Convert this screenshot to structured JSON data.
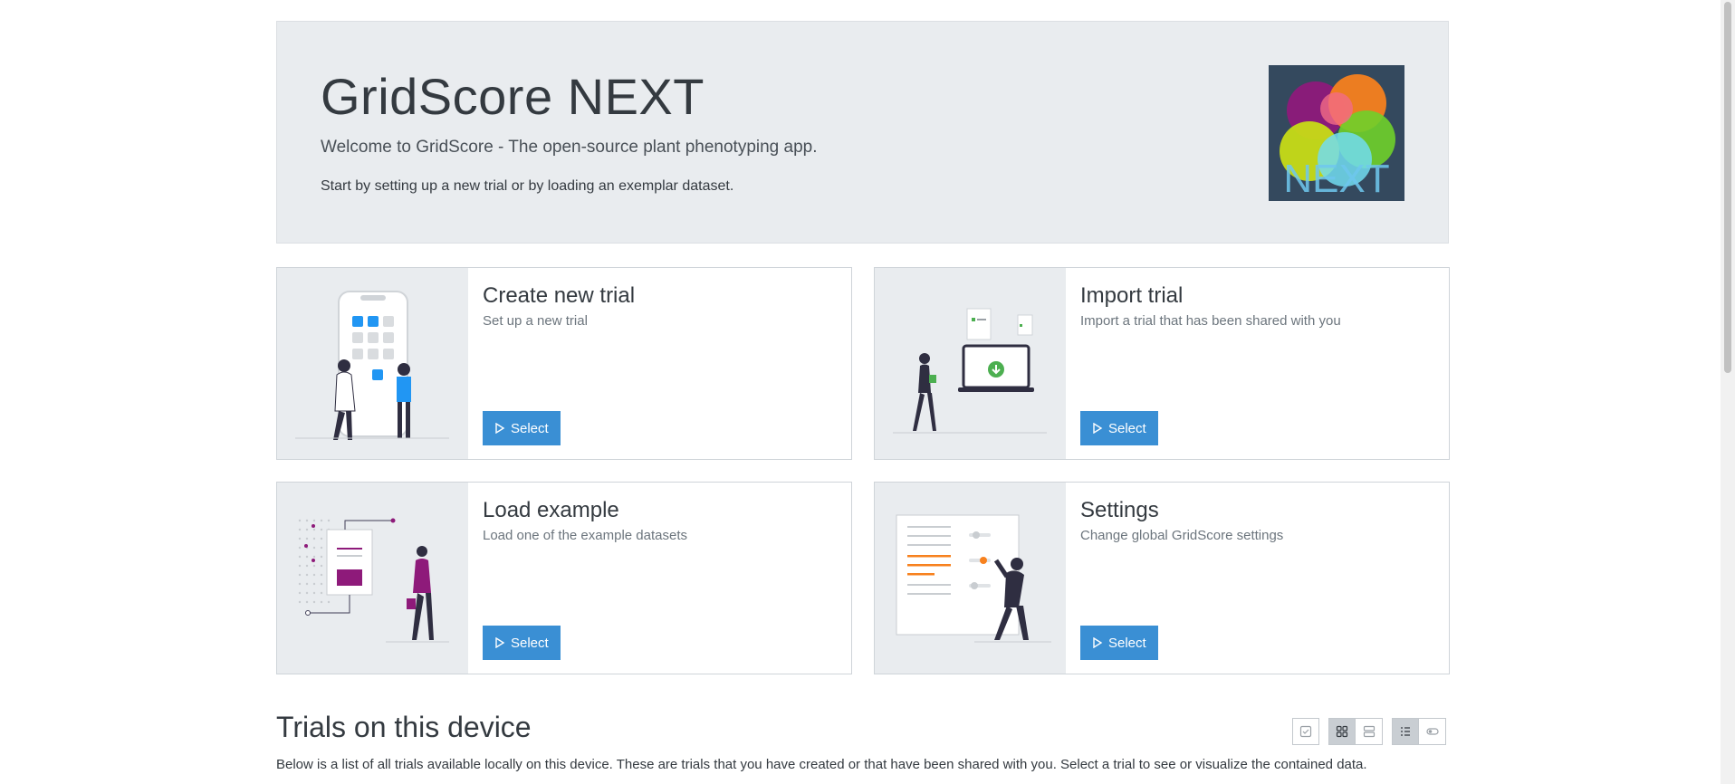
{
  "jumbotron": {
    "title": "GridScore NEXT",
    "lead": "Welcome to GridScore - The open-source plant phenotyping app.",
    "text": "Start by setting up a new trial or by loading an exemplar dataset.",
    "logo_text": "NEXT"
  },
  "cards": [
    {
      "title": "Create new trial",
      "subtitle": "Set up a new trial",
      "button": "Select",
      "icon": "play-icon"
    },
    {
      "title": "Import trial",
      "subtitle": "Import a trial that has been shared with you",
      "button": "Select",
      "icon": "play-icon"
    },
    {
      "title": "Load example",
      "subtitle": "Load one of the example datasets",
      "button": "Select",
      "icon": "play-icon"
    },
    {
      "title": "Settings",
      "subtitle": "Change global GridScore settings",
      "button": "Select",
      "icon": "play-icon"
    }
  ],
  "trials": {
    "heading": "Trials on this device",
    "description": "Below is a list of all trials available locally on this device. These are trials that you have created or that have been shared with you. Select a trial to see or visualize the contained data."
  },
  "view_toggles": [
    {
      "icon": "checkbox-select-icon",
      "active": false
    },
    {
      "icon": "grid-view-icon",
      "active": true
    },
    {
      "icon": "row-view-icon",
      "active": false
    },
    {
      "icon": "list-details-icon",
      "active": true
    },
    {
      "icon": "toggle-icon",
      "active": false
    }
  ],
  "colors": {
    "primary": "#3a8fd4",
    "jumbotron_bg": "#e9ecef",
    "logo_bg": "#34495e",
    "accent_purple": "#8e1a7a",
    "accent_orange": "#f7811e"
  }
}
